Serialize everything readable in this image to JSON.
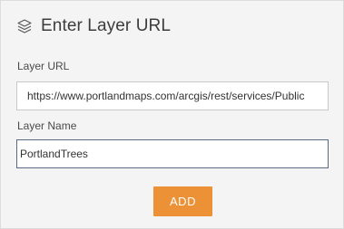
{
  "dialog": {
    "title": "Enter Layer URL",
    "icon": "layers-icon"
  },
  "layer_url": {
    "label": "Layer URL",
    "value": "https://www.portlandmaps.com/arcgis/rest/services/Public"
  },
  "layer_name": {
    "label": "Layer Name",
    "value": "PortlandTrees"
  },
  "actions": {
    "add_label": "ADD"
  },
  "colors": {
    "accent": "#ec9136",
    "focus_border": "#5a6a85"
  }
}
